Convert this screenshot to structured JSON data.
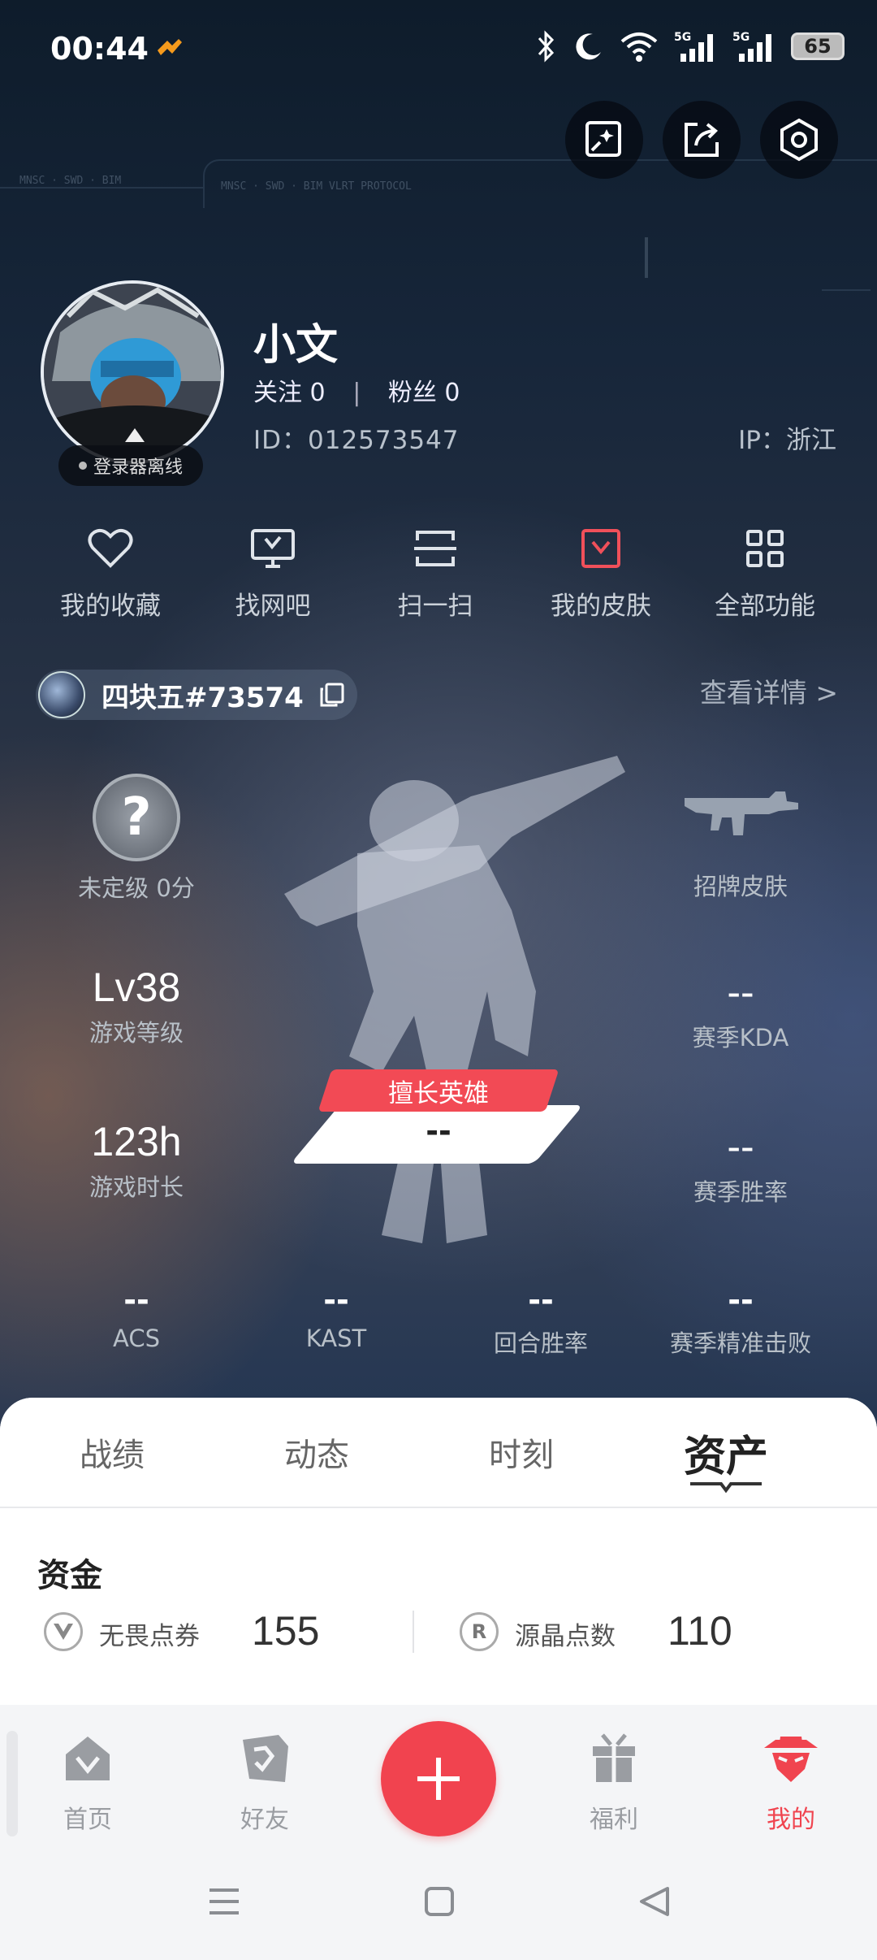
{
  "status_bar": {
    "time": "00:44",
    "battery": "65",
    "icons": [
      "bluetooth-icon",
      "moon-icon",
      "wifi-icon",
      "signal-5g-icon",
      "signal-5g-icon"
    ]
  },
  "top_actions": [
    {
      "name": "edit-card-icon"
    },
    {
      "name": "share-icon"
    },
    {
      "name": "settings-hex-icon"
    }
  ],
  "profile": {
    "name": "小文",
    "follow_label": "关注",
    "follow_count": "0",
    "fans_label": "粉丝",
    "fans_count": "0",
    "separator": "|",
    "id_text": "ID：012573547",
    "ip_text": "IP：浙江",
    "status_badge": "登录器离线"
  },
  "quick_actions": [
    {
      "label": "我的收藏",
      "icon": "heart-icon"
    },
    {
      "label": "找网吧",
      "icon": "monitor-icon"
    },
    {
      "label": "扫一扫",
      "icon": "scan-icon"
    },
    {
      "label": "我的皮肤",
      "icon": "skin-icon"
    },
    {
      "label": "全部功能",
      "icon": "grid-icon"
    }
  ],
  "game_account": {
    "name": "四块五#73574",
    "detail_link": "查看详情 >"
  },
  "stats": {
    "rank": {
      "value": "?",
      "label": "未定级 0分"
    },
    "skin": {
      "label": "招牌皮肤"
    },
    "level": {
      "value": "Lv38",
      "label": "游戏等级"
    },
    "kda": {
      "value": "--",
      "label": "赛季KDA"
    },
    "time": {
      "value": "123h",
      "label": "游戏时长"
    },
    "winrate": {
      "value": "--",
      "label": "赛季胜率"
    },
    "best_hero": {
      "label": "擅长英雄",
      "value": "--"
    }
  },
  "bottom_stats": [
    {
      "value": "--",
      "label": "ACS"
    },
    {
      "value": "--",
      "label": "KAST"
    },
    {
      "value": "--",
      "label": "回合胜率"
    },
    {
      "value": "--",
      "label": "赛季精准击败"
    }
  ],
  "tabs": [
    {
      "label": "战绩",
      "active": false
    },
    {
      "label": "动态",
      "active": false
    },
    {
      "label": "时刻",
      "active": false
    },
    {
      "label": "资产",
      "active": true
    }
  ],
  "assets": {
    "title": "资金",
    "items": [
      {
        "label": "无畏点券",
        "value": "155",
        "icon": "vp-coin-icon"
      },
      {
        "label": "源晶点数",
        "value": "110",
        "icon": "radianite-coin-icon"
      }
    ]
  },
  "bottom_nav": [
    {
      "label": "首页",
      "icon": "home-icon",
      "active": false
    },
    {
      "label": "好友",
      "icon": "friends-icon",
      "active": false
    },
    {
      "label": "",
      "icon": "plus-icon",
      "active": false
    },
    {
      "label": "福利",
      "icon": "gift-icon",
      "active": false
    },
    {
      "label": "我的",
      "icon": "agent-icon",
      "active": true
    }
  ],
  "colors": {
    "accent": "#f1434f",
    "inactive": "#9a9da2",
    "text_dark": "#222222"
  }
}
